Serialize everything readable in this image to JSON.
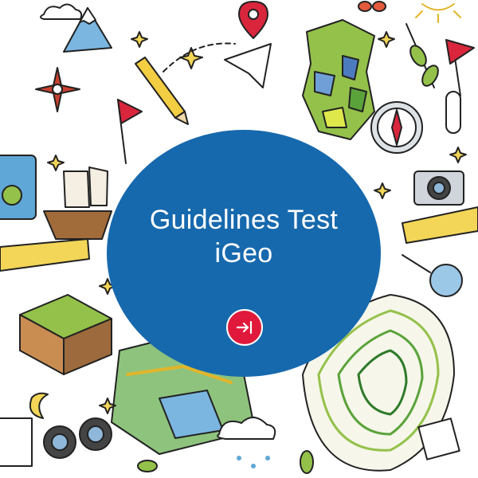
{
  "card": {
    "title_line1": "Guidelines Test",
    "title_line2": "iGeo",
    "circle_color": "#1769ad",
    "button_color": "#e0193c",
    "button_icon": "arrow-right-to-line-icon"
  }
}
